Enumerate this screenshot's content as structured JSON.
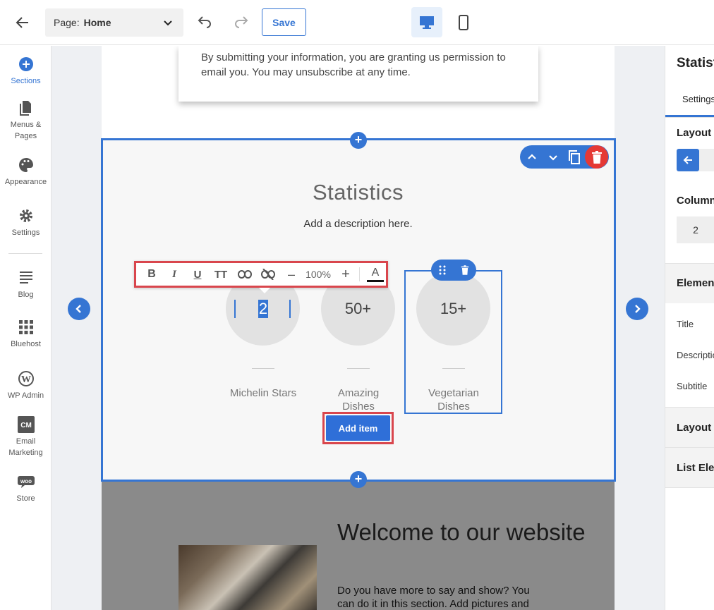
{
  "topbar": {
    "page_label": "Page:",
    "page_value": "Home",
    "save_label": "Save"
  },
  "sidebar": {
    "items": [
      {
        "label": "Sections",
        "icon": "plus-circle-icon"
      },
      {
        "label": "Menus &\nPages",
        "icon": "pages-icon"
      },
      {
        "label": "Appearance",
        "icon": "palette-icon"
      },
      {
        "label": "Settings",
        "icon": "gear-icon"
      },
      {
        "label": "Blog",
        "icon": "blog-icon"
      },
      {
        "label": "Bluehost",
        "icon": "grid-icon"
      },
      {
        "label": "WP Admin",
        "icon": "wordpress-icon"
      },
      {
        "label": "Email\nMarketing",
        "icon": "cm-icon"
      },
      {
        "label": "Store",
        "icon": "woo-icon"
      }
    ]
  },
  "canvas": {
    "form_disclaimer": "By submitting your information, you are granting us permission to email you. You may unsubscribe at any time.",
    "stats": {
      "title": "Statistics",
      "description": "Add a description here.",
      "items": [
        {
          "value": "2",
          "label": "Michelin Stars"
        },
        {
          "value": "50+",
          "label": "Amazing Dishes"
        },
        {
          "value": "15+",
          "label": "Vegetarian Dishes"
        }
      ],
      "add_item_label": "Add item"
    },
    "text_toolbar": {
      "bold": "B",
      "italic": "I",
      "underline": "U",
      "font_size": "TT",
      "zoom": "100%",
      "minus": "–",
      "plus": "+",
      "text_color": "A"
    },
    "welcome": {
      "title": "Welcome to our website",
      "text": "Do you have more to say and show? You can do it in this section. Add pictures and"
    }
  },
  "right_panel": {
    "title": "Statistics",
    "tab": "Settings",
    "layout_heading": "Layout",
    "columns_heading": "Columns",
    "columns_value": "2",
    "elements_heading": "Elements",
    "element_rows": [
      "Title",
      "Description",
      "Subtitle"
    ],
    "layout2_heading": "Layout",
    "list_heading": "List Elements"
  },
  "colors": {
    "accent": "#3575d3",
    "danger": "#e53935",
    "highlight_outline": "#d9464d"
  }
}
